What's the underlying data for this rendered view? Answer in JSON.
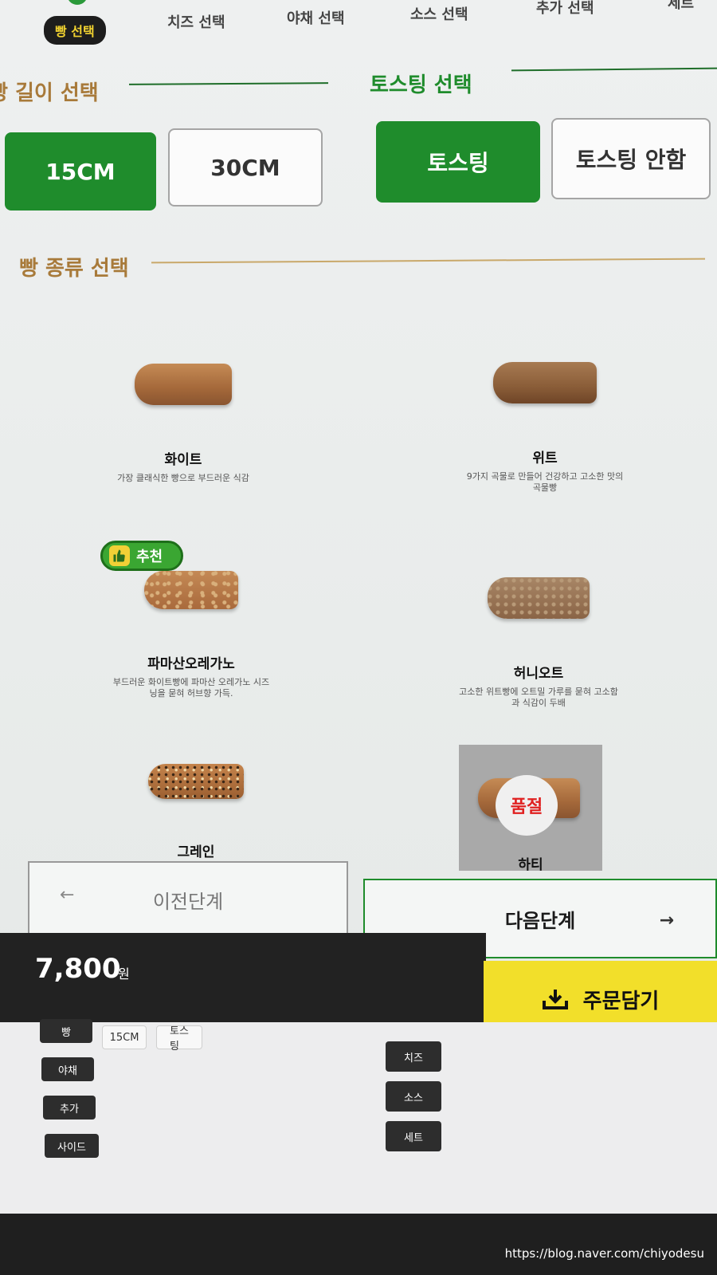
{
  "steps": {
    "active": "빵 선택",
    "items": [
      "치즈 선택",
      "야채 선택",
      "소스 선택",
      "추가 선택",
      "세트"
    ]
  },
  "length_section": {
    "title": "빵 길이 선택",
    "options": [
      "15CM",
      "30CM"
    ],
    "selected": "15CM"
  },
  "toasting_section": {
    "title": "토스팅 선택",
    "options": [
      "토스팅",
      "토스팅 안함"
    ],
    "selected": "토스팅"
  },
  "bread_section": {
    "title": "빵 종류 선택",
    "recommend_label": "추천",
    "soldout_label": "품절",
    "items": [
      {
        "name": "화이트",
        "desc": "가장 클래식한 빵으로 부드러운 식감"
      },
      {
        "name": "위트",
        "desc": "9가지 곡물로 만들어 건강하고 고소한 맛의 곡물빵"
      },
      {
        "name": "파마산오레가노",
        "desc": "부드러운 화이트빵에 파마산 오레가노 시즈닝을 묻혀 허브향 가득."
      },
      {
        "name": "허니오트",
        "desc": "고소한 위트빵에 오트밀 가루를 묻혀 고소함과 식감이 두배"
      },
      {
        "name": "그레인",
        "desc": ""
      },
      {
        "name": "하티",
        "desc": ""
      }
    ]
  },
  "nav": {
    "prev": "이전단계",
    "next": "다음단계",
    "prev_arrow": "←",
    "next_arrow": "→"
  },
  "cart": {
    "price": "7,800",
    "unit": "원",
    "order_button": "주문담기",
    "summary_left": [
      {
        "label": "빵",
        "values": [
          "15CM",
          "토스팅"
        ]
      },
      {
        "label": "야채",
        "values": []
      },
      {
        "label": "추가",
        "values": []
      },
      {
        "label": "사이드",
        "values": []
      }
    ],
    "summary_right": [
      "치즈",
      "소스",
      "세트"
    ]
  },
  "watermark": "https://blog.naver.com/chiyodesu",
  "colors": {
    "brand_green": "#1f8c2c",
    "accent_yellow": "#f2df2a",
    "title_brown": "#a87a3a"
  }
}
